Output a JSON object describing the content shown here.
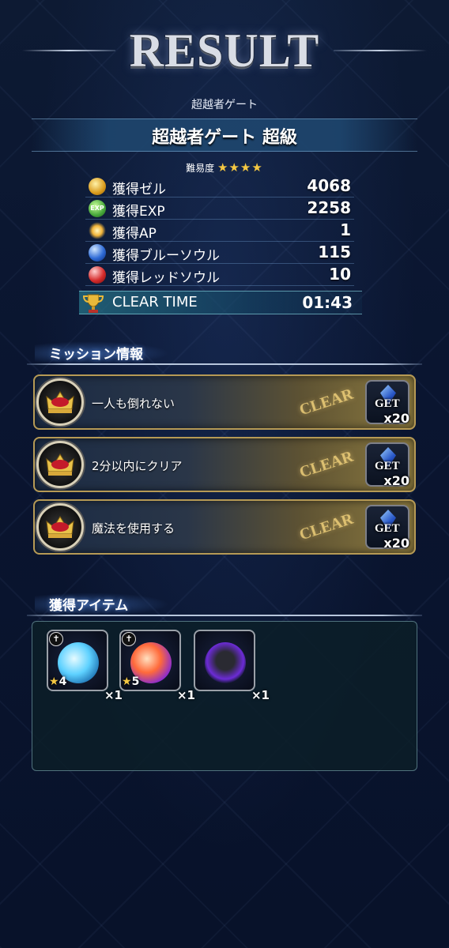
{
  "title": "RESULT",
  "quest": {
    "category": "超越者ゲート",
    "name": "超越者ゲート 超級",
    "difficulty_label": "難易度",
    "difficulty_stars": "★★★★"
  },
  "stats": [
    {
      "icon": "zel-coin-icon",
      "label": "獲得ゼル",
      "value": "4068"
    },
    {
      "icon": "exp-icon",
      "label": "獲得EXP",
      "value": "2258"
    },
    {
      "icon": "ap-icon",
      "label": "獲得AP",
      "value": "1"
    },
    {
      "icon": "blue-soul-icon",
      "label": "獲得ブルーソウル",
      "value": "115"
    },
    {
      "icon": "red-soul-icon",
      "label": "獲得レッドソウル",
      "value": "10"
    }
  ],
  "exp_icon_text": "EXP",
  "clear_time": {
    "label": "CLEAR TIME",
    "value": "01:43"
  },
  "missions_header": "ミッション情報",
  "missions": [
    {
      "text": "一人も倒れない",
      "stamp": "CLEAR",
      "reward_label": "GET",
      "reward_count": "x20"
    },
    {
      "text": "2分以内にクリア",
      "stamp": "CLEAR",
      "reward_label": "GET",
      "reward_count": "x20"
    },
    {
      "text": "魔法を使用する",
      "stamp": "CLEAR",
      "reward_label": "GET",
      "reward_count": "x20"
    }
  ],
  "items_header": "獲得アイテム",
  "items": [
    {
      "type": "ice-sphere",
      "rarity": "4",
      "qty": "×1"
    },
    {
      "type": "fire-sphere",
      "rarity": "5",
      "qty": "×1"
    },
    {
      "type": "dark-crystal",
      "rarity": "",
      "qty": "×1"
    }
  ],
  "colors": {
    "accent_gold": "#b69a55",
    "star": "#f5c842",
    "panel_teal": "#0c1e28"
  }
}
